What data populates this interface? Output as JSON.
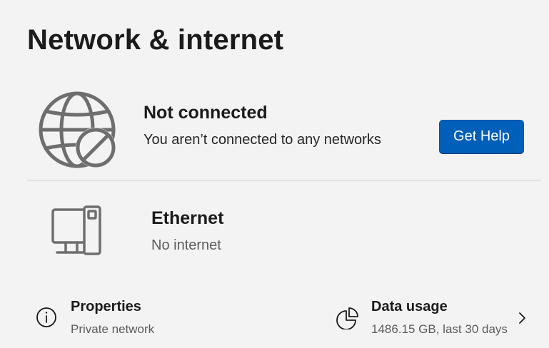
{
  "page": {
    "title": "Network & internet"
  },
  "status": {
    "title": "Not connected",
    "description": "You aren’t connected to any networks",
    "icon": "globe-blocked-icon",
    "help_button_label": "Get Help"
  },
  "ethernet": {
    "title": "Ethernet",
    "status": "No internet",
    "icon": "ethernet-computer-icon"
  },
  "properties": {
    "title": "Properties",
    "subtitle": "Private network",
    "icon": "info-icon"
  },
  "data_usage": {
    "title": "Data usage",
    "subtitle": "1486.15 GB, last 30 days",
    "icon": "pie-chart-icon",
    "chevron_icon": "chevron-right-icon"
  },
  "colors": {
    "accent": "#005fb8",
    "background": "#f3f3f3",
    "icon": "#6e6e6e"
  }
}
